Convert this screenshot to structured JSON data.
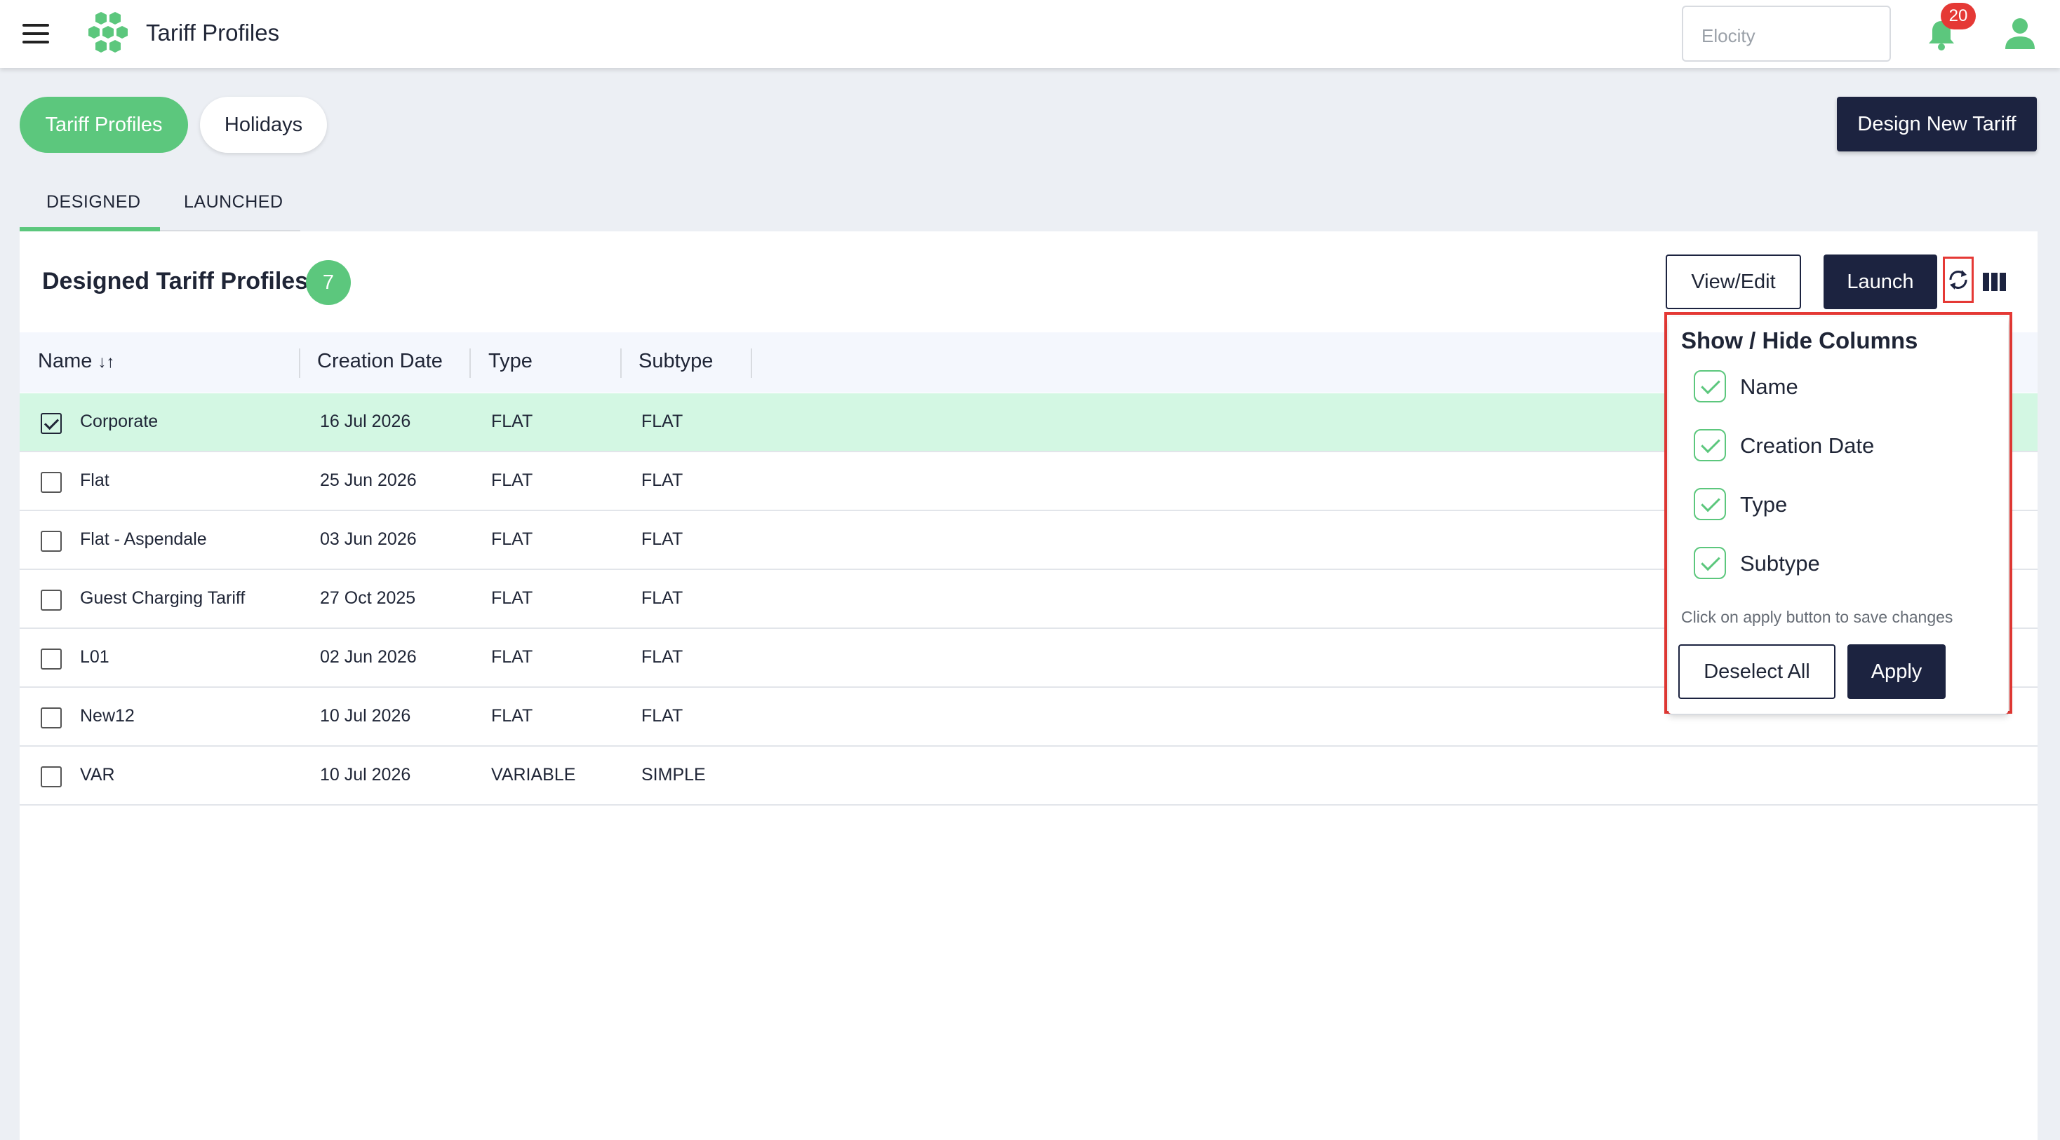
{
  "header": {
    "app_title": "Tariff Profiles",
    "org_select_placeholder": "Elocity",
    "notification_count": "20",
    "brand_color": "#5cc77d",
    "icons": [
      "hamburger-menu-icon",
      "hexagon-logo-icon",
      "bell-icon",
      "user-icon"
    ]
  },
  "top_pills": [
    {
      "label": "Tariff Profiles",
      "active": true
    },
    {
      "label": "Holidays",
      "active": false
    }
  ],
  "design_button_label": "Design New Tariff",
  "tabs": [
    {
      "label": "DESIGNED",
      "active": true
    },
    {
      "label": "LAUNCHED",
      "active": false
    }
  ],
  "panel": {
    "title": "Designed Tariff Profiles",
    "count": "7",
    "view_edit_label": "View/Edit",
    "launch_label": "Launch",
    "icons": [
      "refresh-icon",
      "columns-icon"
    ]
  },
  "table": {
    "columns": [
      "Name",
      "Creation Date",
      "Type",
      "Subtype"
    ],
    "sort_indicator": "↓↑",
    "rows": [
      {
        "name": "Corporate",
        "date": "16 Jul 2026",
        "type": "FLAT",
        "subtype": "FLAT",
        "selected": true
      },
      {
        "name": "Flat",
        "date": "25 Jun 2026",
        "type": "FLAT",
        "subtype": "FLAT",
        "selected": false
      },
      {
        "name": "Flat - Aspendale",
        "date": "03 Jun 2026",
        "type": "FLAT",
        "subtype": "FLAT",
        "selected": false
      },
      {
        "name": "Guest Charging Tariff",
        "date": "27 Oct 2025",
        "type": "FLAT",
        "subtype": "FLAT",
        "selected": false
      },
      {
        "name": "L01",
        "date": "02 Jun 2026",
        "type": "FLAT",
        "subtype": "FLAT",
        "selected": false
      },
      {
        "name": "New12",
        "date": "10 Jul 2026",
        "type": "FLAT",
        "subtype": "FLAT",
        "selected": false
      },
      {
        "name": "VAR",
        "date": "10 Jul 2026",
        "type": "VARIABLE",
        "subtype": "SIMPLE",
        "selected": false
      }
    ]
  },
  "column_popover": {
    "title": "Show / Hide Columns",
    "options": [
      {
        "label": "Name",
        "checked": true
      },
      {
        "label": "Creation Date",
        "checked": true
      },
      {
        "label": "Type",
        "checked": true
      },
      {
        "label": "Subtype",
        "checked": true
      }
    ],
    "hint": "Click on apply button to save changes",
    "deselect_label": "Deselect All",
    "apply_label": "Apply"
  }
}
